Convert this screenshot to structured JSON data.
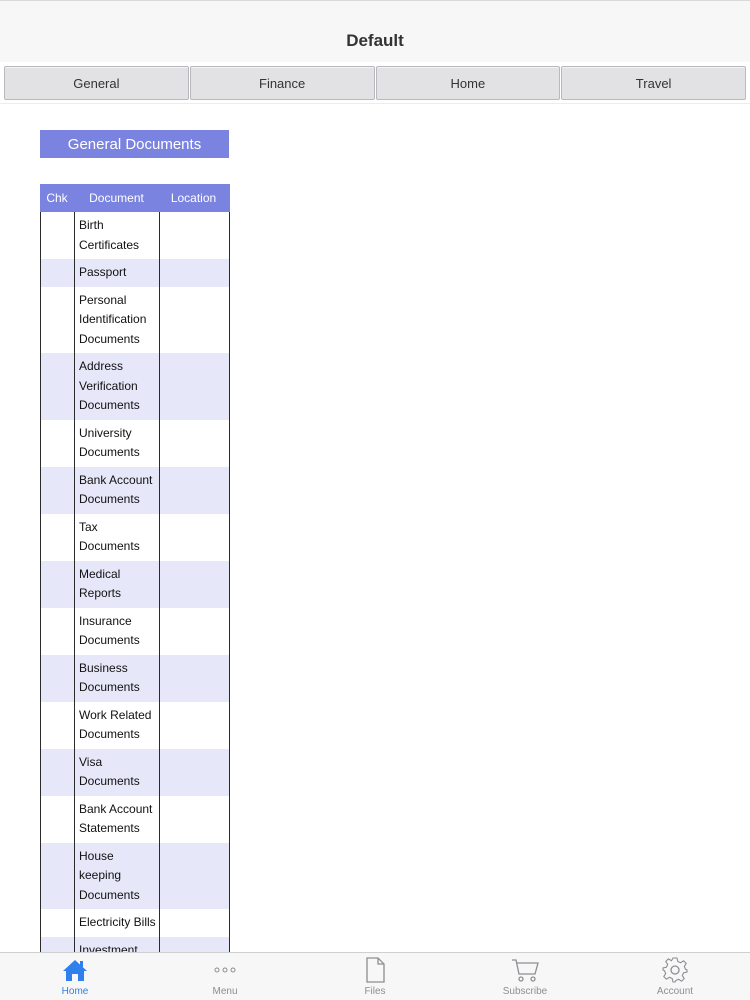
{
  "navbar": {
    "title": "Default"
  },
  "tabs": [
    {
      "label": "General"
    },
    {
      "label": "Finance"
    },
    {
      "label": "Home"
    },
    {
      "label": "Travel"
    }
  ],
  "section": {
    "title": "General Documents"
  },
  "table": {
    "headers": {
      "chk": "Chk",
      "document": "Document",
      "location": "Location"
    },
    "rows": [
      {
        "document": "Birth\nCertificates",
        "location": ""
      },
      {
        "document": "Passport",
        "location": ""
      },
      {
        "document": "Personal\nIdentification\nDocuments",
        "location": ""
      },
      {
        "document": "Address\nVerification\nDocuments",
        "location": ""
      },
      {
        "document": "University\nDocuments",
        "location": ""
      },
      {
        "document": "Bank Account\nDocuments",
        "location": ""
      },
      {
        "document": "Tax\nDocuments",
        "location": ""
      },
      {
        "document": "Medical\nReports",
        "location": ""
      },
      {
        "document": "Insurance\nDocuments",
        "location": ""
      },
      {
        "document": "Business\nDocuments",
        "location": ""
      },
      {
        "document": "Work Related\nDocuments",
        "location": ""
      },
      {
        "document": "Visa\nDocuments",
        "location": ""
      },
      {
        "document": "Bank Account\nStatements",
        "location": ""
      },
      {
        "document": "House\nkeeping\nDocuments",
        "location": ""
      },
      {
        "document": "Electricity Bills",
        "location": ""
      },
      {
        "document": "Investment",
        "location": ""
      }
    ]
  },
  "tabbar": {
    "items": [
      {
        "label": "Home",
        "icon": "home-icon",
        "active": true
      },
      {
        "label": "Menu",
        "icon": "more-icon",
        "active": false
      },
      {
        "label": "Files",
        "icon": "file-icon",
        "active": false
      },
      {
        "label": "Subscribe",
        "icon": "cart-icon",
        "active": false
      },
      {
        "label": "Account",
        "icon": "gear-icon",
        "active": false
      }
    ]
  },
  "colors": {
    "accent": "#7b83e0",
    "row_alt": "#e6e8fa",
    "active_tab": "#2f80ed",
    "inactive_tab": "#8e8e93"
  }
}
